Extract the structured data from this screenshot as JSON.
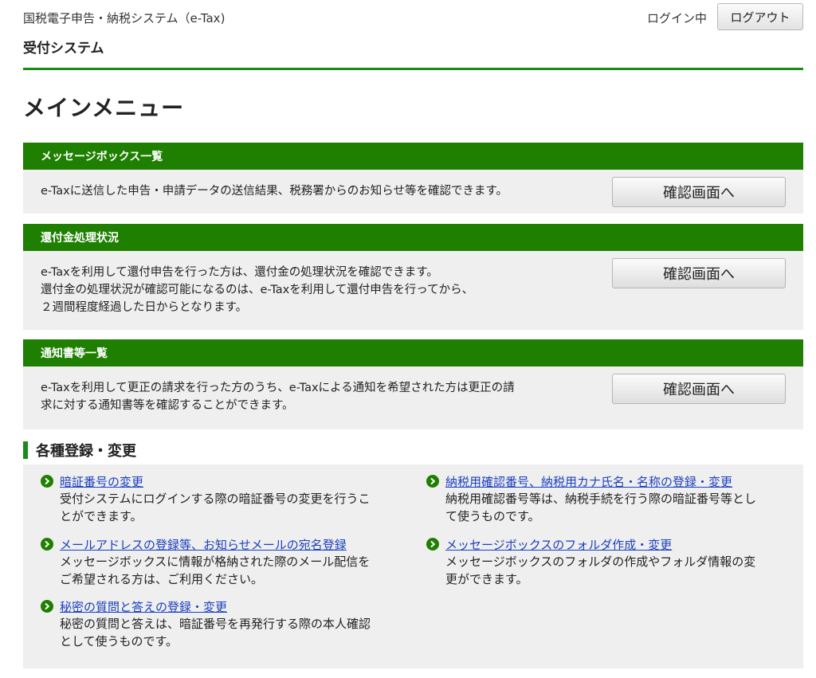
{
  "header": {
    "system_name": "国税電子申告・納税システム（e-Tax)",
    "sub_system": "受付システム",
    "login_status": "ログイン中",
    "logout_label": "ログアウト"
  },
  "page_title": "メインメニュー",
  "panels": [
    {
      "title": "メッセージボックス一覧",
      "lines": [
        "e-Taxに送信した申告・申請データの送信結果、税務署からのお知らせ等を確認できます。"
      ],
      "button": "確認画面へ"
    },
    {
      "title": "還付金処理状況",
      "lines": [
        "e-Taxを利用して還付申告を行った方は、還付金の処理状況を確認できます。",
        "還付金の処理状況が確認可能になるのは、e-Taxを利用して還付申告を行ってから、",
        "２週間程度経過した日からとなります。"
      ],
      "button": "確認画面へ"
    },
    {
      "title": "通知書等一覧",
      "lines": [
        "e-Taxを利用して更正の請求を行った方のうち、e-Taxによる通知を希望された方は更正の請",
        "求に対する通知書等を確認することができます。"
      ],
      "button": "確認画面へ"
    }
  ],
  "registration": {
    "title": "各種登録・変更",
    "items": [
      {
        "link": "暗証番号の変更",
        "desc": [
          "受付システムにログインする際の暗証番号の変更を行うこ",
          "とができます。"
        ]
      },
      {
        "link": "メールアドレスの登録等、お知らせメールの宛名登録",
        "desc": [
          "メッセージボックスに情報が格納された際のメール配信を",
          "ご希望される方は、ご利用ください。"
        ]
      },
      {
        "link": "秘密の質問と答えの登録・変更",
        "desc": [
          "秘密の質問と答えは、暗証番号を再発行する際の本人確認",
          "として使うものです。"
        ]
      },
      {
        "link": "納税用確認番号、納税用カナ氏名・名称の登録・変更",
        "desc": [
          "納税用確認番号等は、納税手続を行う際の暗証番号等とし",
          "て使うものです。"
        ]
      },
      {
        "link": "メッセージボックスのフォルダ作成・変更",
        "desc": [
          "メッセージボックスのフォルダの作成やフォルダ情報の変",
          "更ができます。"
        ]
      }
    ]
  },
  "colors": {
    "accent_green": "#1f7f00",
    "link_blue": "#1a3fbf",
    "panel_bg": "#efefef"
  }
}
